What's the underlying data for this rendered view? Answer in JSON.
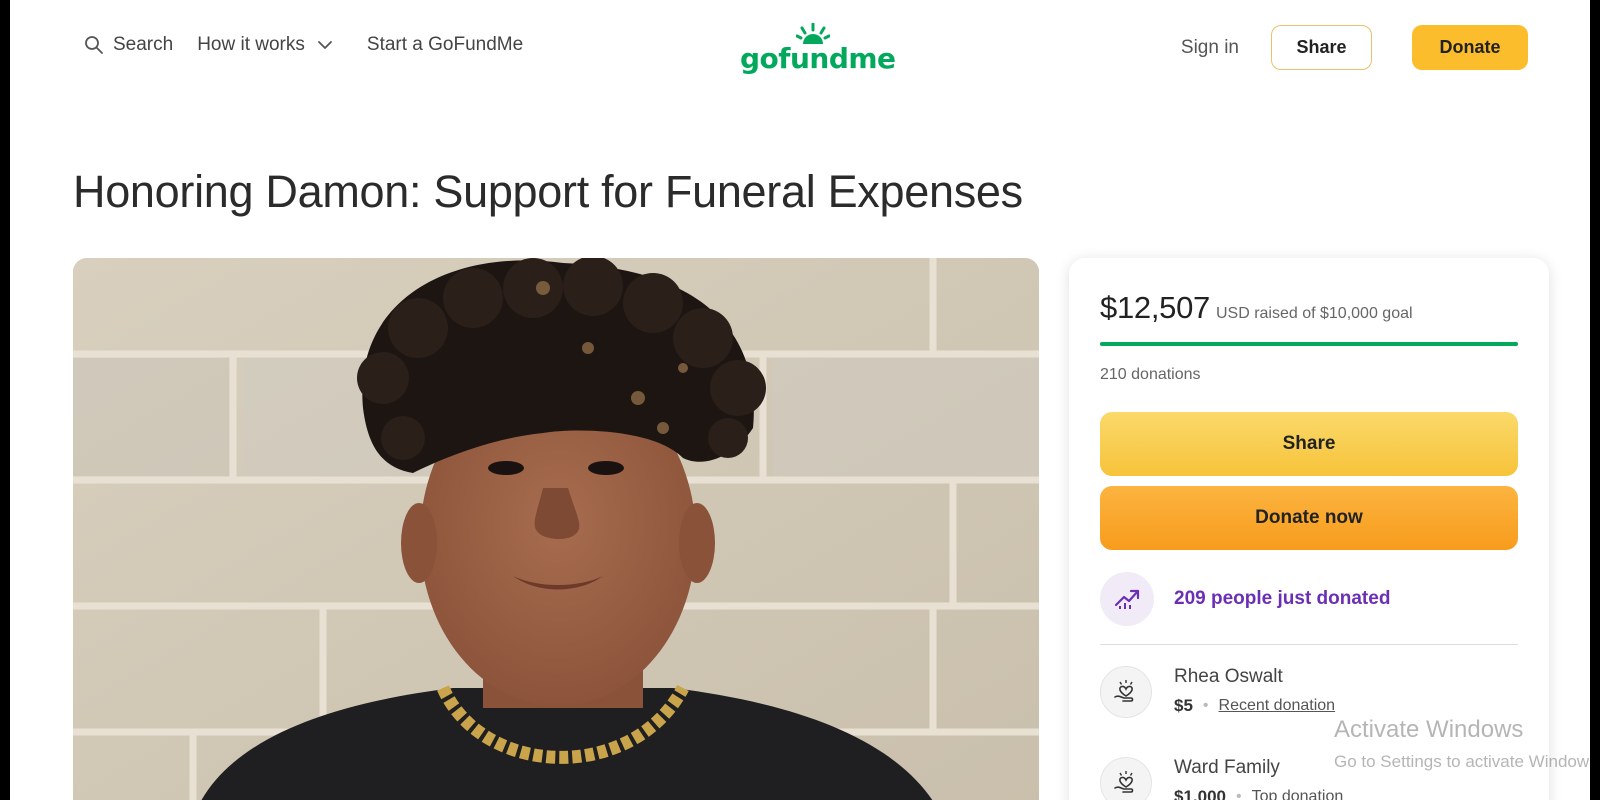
{
  "header": {
    "search_label": "Search",
    "how_it_works_label": "How it works",
    "start_label": "Start a GoFundMe",
    "logo_text": "gofundme",
    "signin_label": "Sign in",
    "share_label": "Share",
    "donate_label": "Donate"
  },
  "campaign": {
    "title": "Honoring Damon: Support for Funeral Expenses"
  },
  "card": {
    "raised_amount": "$12,507",
    "raised_text": "USD raised of $10,000 goal",
    "progress_fraction": 1.0,
    "donations_count": "210 donations",
    "share_label": "Share",
    "donate_now_label": "Donate now",
    "trend_text": "209 people just donated",
    "donors": [
      {
        "name": "Rhea Oswalt",
        "amount": "$5",
        "tag": "Recent donation"
      },
      {
        "name": "Ward Family",
        "amount": "$1,000",
        "tag": "Top donation"
      }
    ]
  },
  "watermark": {
    "title": "Activate Windows",
    "subtitle": "Go to Settings to activate Windows."
  },
  "colors": {
    "brand_green": "#02a95c",
    "donate_yellow": "#fbbd2b",
    "trend_purple": "#6b2fb6"
  },
  "icons": {
    "search": "search-icon",
    "chevron": "chevron-down-icon",
    "trend": "trending-up-icon",
    "donor": "heart-hand-icon"
  }
}
